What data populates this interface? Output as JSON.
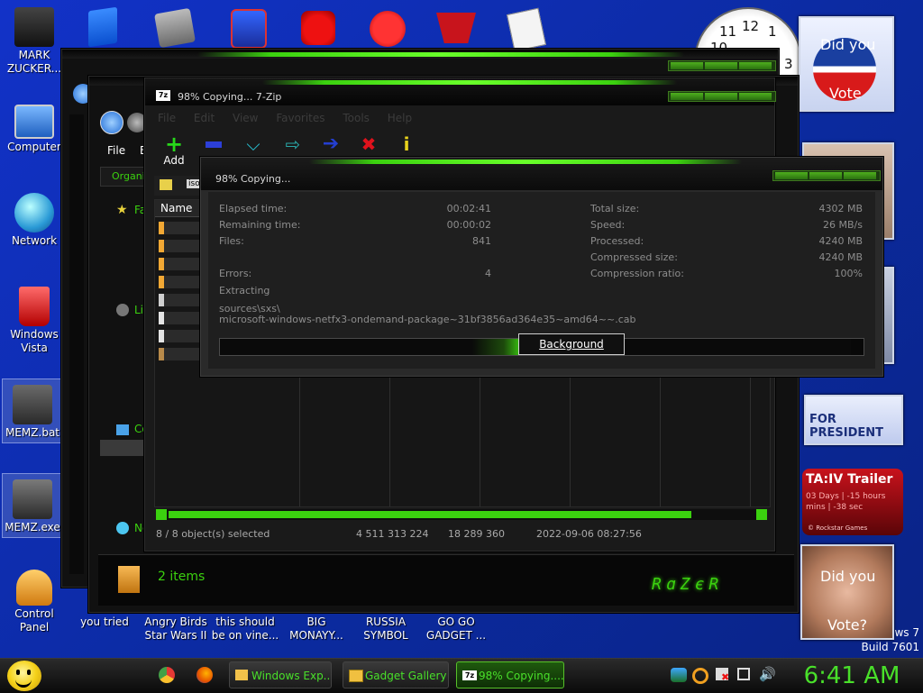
{
  "desktop": {
    "icons_left": [
      {
        "label": "MARK ZUCKER..."
      },
      {
        "label": "Computer"
      },
      {
        "label": "Network"
      },
      {
        "label": "Windows Vista"
      },
      {
        "label": "MEMZ.bat"
      },
      {
        "label": "MEMZ.exe"
      },
      {
        "label": "Control Panel"
      }
    ],
    "icons_bottom": [
      {
        "label": "you tried"
      },
      {
        "label": "Angry Birds Star Wars II"
      },
      {
        "label": "this should be on vine..."
      },
      {
        "label": "BIG MONAYY..."
      },
      {
        "label": "RUSSIA SYMBOL"
      },
      {
        "label": "GO GO GADGET ..."
      }
    ],
    "watermark_line1": "ows 7",
    "watermark_line2": "Build 7601"
  },
  "gadgets": {
    "did_you_vote_top": "Did you",
    "vote_bottom": "Vote",
    "for_president": "FOR PRESIDENT",
    "gta_title": "TA:IV Trailer",
    "gta_line1": "03 Days | -15 hours",
    "gta_line2": "mins | -38 sec",
    "gta_footer": "© Rockstar Games",
    "did_you_vote2_top": "Did you",
    "did_you_vote2_bottom": "Vote?",
    "clock_numbers": [
      "12",
      "10",
      "11",
      "1",
      "3"
    ]
  },
  "explorer": {
    "file_menu": "File",
    "edit_menu": "E",
    "organize": "Organiz",
    "fav_label": "Fa",
    "lib_label": "Li",
    "comp_label": "Co",
    "net_label": "Ne",
    "items_count": "2 items"
  },
  "sevenzip": {
    "title": "98% Copying... 7-Zip",
    "menu": [
      "File",
      "Edit",
      "View",
      "Favorites",
      "Tools",
      "Help"
    ],
    "toolbar": [
      {
        "label": "Add",
        "icon": "plus-icon",
        "color": "#27d81a"
      },
      {
        "label": "Extract",
        "icon": "minus-icon",
        "color": "#2c3fd8"
      },
      {
        "label": "Test",
        "icon": "check-icon",
        "color": "#28c6d8"
      },
      {
        "label": "Copy",
        "icon": "copy-arrow-icon",
        "color": "#2aa8a8"
      },
      {
        "label": "Move",
        "icon": "move-arrow-icon",
        "color": "#243fd0"
      },
      {
        "label": "Delete",
        "icon": "delete-x-icon",
        "color": "#e0121c"
      },
      {
        "label": "Info",
        "icon": "info-icon",
        "color": "#e8d21c"
      }
    ],
    "column_name": "Name",
    "path_tag": "iso",
    "status": {
      "selected": "8 / 8 object(s) selected",
      "size": "4 511 313 224",
      "packed": "18 289 360",
      "date": "2022-09-06 08:27:56"
    }
  },
  "progress": {
    "title": "98% Copying...",
    "elapsed_label": "Elapsed time:",
    "elapsed_value": "00:02:41",
    "remaining_label": "Remaining time:",
    "remaining_value": "00:00:02",
    "files_label": "Files:",
    "files_value": "841",
    "errors_label": "Errors:",
    "errors_value": "4",
    "total_label": "Total size:",
    "total_value": "4302 MB",
    "speed_label": "Speed:",
    "speed_value": "26 MB/s",
    "processed_label": "Processed:",
    "processed_value": "4240 MB",
    "compressed_label": "Compressed size:",
    "compressed_value": "4240 MB",
    "ratio_label": "Compression ratio:",
    "ratio_value": "100%",
    "extracting": "Extracting",
    "path_line1": "sources\\sxs\\",
    "path_line2": "microsoft-windows-netfx3-ondemand-package~31bf3856ad364e35~amd64~~.cab",
    "percent": 98,
    "background_button": "Background"
  },
  "taskbar": {
    "tasks": [
      {
        "label": "Windows Exp..."
      },
      {
        "label": "Gadget Gallery"
      },
      {
        "label": "98% Copying...."
      }
    ],
    "clock": "6:41 AM"
  },
  "colors": {
    "accent_green": "#3bd10f",
    "clock_green": "#49e02a"
  }
}
